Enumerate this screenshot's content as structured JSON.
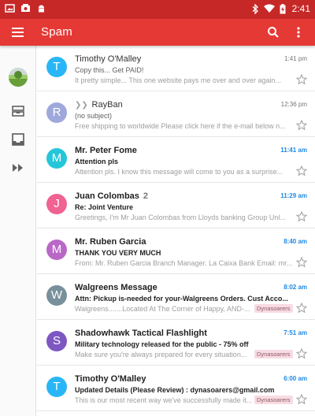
{
  "status_bar": {
    "time": "2:41"
  },
  "app_bar": {
    "title": "Spam"
  },
  "rail": {
    "icons": [
      "inbox-stack-icon",
      "inbox-icon",
      "forward-arrows-icon"
    ]
  },
  "emails": [
    {
      "initial": "T",
      "color": "#29b6f6",
      "sender": "Timothy O'Malley",
      "count": "",
      "forwarded": false,
      "time": "1:41 pm",
      "subject": "Copy this... Get PAID!",
      "snippet": "It pretty simple... This one website pays me over and over again...",
      "label": "",
      "unread": false
    },
    {
      "initial": "R",
      "color": "#9fa8da",
      "sender": "RayBan",
      "count": "",
      "forwarded": true,
      "time": "12:36 pm",
      "subject": "(no subject)",
      "snippet": "Free shipping to worldwide Please click here if the e-mail below n...",
      "label": "",
      "unread": false
    },
    {
      "initial": "M",
      "color": "#26c6da",
      "sender": "Mr. Peter Fome",
      "count": "",
      "forwarded": false,
      "time": "11:41 am",
      "subject": "Attention pls",
      "snippet": "Attention pls. I know this message will come to you as a surprise...",
      "label": "",
      "unread": true
    },
    {
      "initial": "J",
      "color": "#f06292",
      "sender": "Juan Colombas",
      "count": "2",
      "forwarded": false,
      "time": "11:29 am",
      "subject": "Re: Joint Venture",
      "snippet": "Greetings, I'm Mr Juan Colombas from Lloyds banking Group Unl...",
      "label": "",
      "unread": true
    },
    {
      "initial": "M",
      "color": "#ba68c8",
      "sender": "Mr. Ruben Garcia",
      "count": "",
      "forwarded": false,
      "time": "8:40 am",
      "subject": "THANK YOU VERY MUCH",
      "snippet": "From: Mr. Ruben Garcia Branch Manager. La Caixa Bank Email: mr...",
      "label": "",
      "unread": true
    },
    {
      "initial": "W",
      "color": "#78909c",
      "sender": "Walgreens Message",
      "count": "",
      "forwarded": false,
      "time": "8:02 am",
      "subject": "Attn: Pickup is-needed for your-Walgreens Orders. Cust Acco...",
      "snippet": "Walgreens.......Located At The Corner of Happy, AND-...",
      "label": "Dynasoarers",
      "unread": true
    },
    {
      "initial": "S",
      "color": "#7e57c2",
      "sender": "Shadowhawk Tactical Flashlight",
      "count": "",
      "forwarded": false,
      "time": "7:51 am",
      "subject": "Military technology released for the public - 75% off",
      "snippet": "Make sure you're always prepared for every situation...",
      "label": "Dynasoarers",
      "unread": true
    },
    {
      "initial": "T",
      "color": "#29b6f6",
      "sender": "Timothy O'Malley",
      "count": "",
      "forwarded": false,
      "time": "6:00 am",
      "subject": "Updated Details (Please Review) : dynasoarers@gmail.com",
      "snippet": "This is our most recent way we've successfully made it...",
      "label": "Dynasoarers",
      "unread": true
    }
  ]
}
